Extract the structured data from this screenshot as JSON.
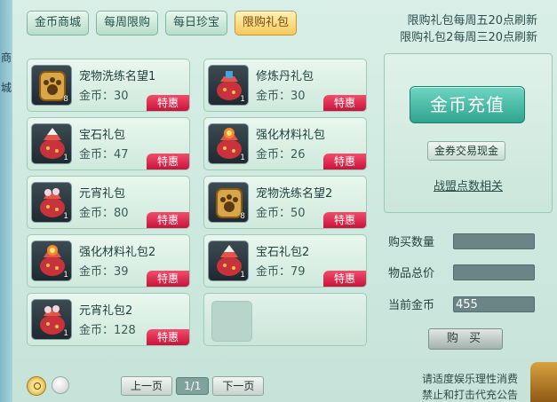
{
  "left_strip": {
    "chars": [
      "商",
      "城"
    ]
  },
  "tabs": [
    {
      "label": "金币商城",
      "active": false
    },
    {
      "label": "每周限购",
      "active": false
    },
    {
      "label": "每日珍宝",
      "active": false
    },
    {
      "label": "限购礼包",
      "active": true
    }
  ],
  "notice": {
    "line1": "限购礼包每周五20点刷新",
    "line2": "限购礼包2每周三20点刷新"
  },
  "items": [
    {
      "name": "宠物洗练名望1",
      "price": "金币：30",
      "count": "8",
      "badge": "特惠",
      "icon": "paw-badge-icon"
    },
    {
      "name": "修炼丹礼包",
      "price": "金币：30",
      "count": "1",
      "badge": "特惠",
      "icon": "gift-bag-icon"
    },
    {
      "name": "宝石礼包",
      "price": "金币：47",
      "count": "1",
      "badge": "特惠",
      "icon": "gift-bag-icon"
    },
    {
      "name": "强化材料礼包",
      "price": "金币：26",
      "count": "1",
      "badge": "特惠",
      "icon": "gift-bag-icon"
    },
    {
      "name": "元宵礼包",
      "price": "金币：80",
      "count": "1",
      "badge": "特惠",
      "icon": "gift-bag-icon"
    },
    {
      "name": "宠物洗练名望2",
      "price": "金币：50",
      "count": "8",
      "badge": "特惠",
      "icon": "paw-badge-icon"
    },
    {
      "name": "强化材料礼包2",
      "price": "金币：39",
      "count": "1",
      "badge": "特惠",
      "icon": "gift-bag-icon"
    },
    {
      "name": "宝石礼包2",
      "price": "金币：79",
      "count": "1",
      "badge": "特惠",
      "icon": "gift-bag-icon"
    },
    {
      "name": "元宵礼包2",
      "price": "金币：128",
      "count": "1",
      "badge": "特惠",
      "icon": "gift-bag-icon"
    }
  ],
  "pager": {
    "prev": "上一页",
    "page": "1/1",
    "next": "下一页"
  },
  "right": {
    "recharge": "金币充值",
    "voucher": "金券交易现金",
    "alliance": "战盟点数相关"
  },
  "form": {
    "qty_label": "购买数量",
    "total_label": "物品总价",
    "gold_label": "当前金币",
    "qty_value": "",
    "total_value": "",
    "gold_value": "455",
    "buy": "购 买"
  },
  "footer": {
    "line1": "请适度娱乐理性消费",
    "line2": "禁止和打击代充公告"
  },
  "colors": {
    "accent_teal": "#2ea48e",
    "badge_red": "#d9244a",
    "tab_active": "#f5c95b"
  }
}
